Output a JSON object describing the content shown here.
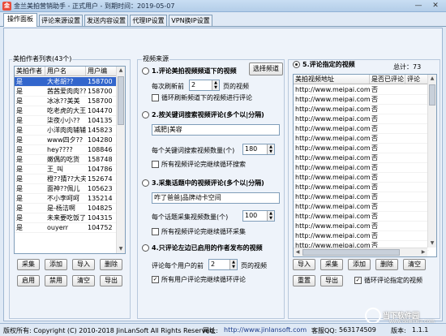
{
  "window": {
    "title": "金兰美拍营销助手 - 正式用户 - 到期时间：2019-05-07",
    "minimize": "—",
    "close": "✕"
  },
  "tabs": [
    "操作面板",
    "评论来源设置",
    "发送内容设置",
    "代理IP设置",
    "VPN换IP设置"
  ],
  "authors": {
    "group_label": "美拍作者列表(43个)",
    "columns": [
      "美拍作者",
      "用户名",
      "用户编"
    ],
    "rows": [
      [
        "是",
        "大老胡??",
        "158700"
      ],
      [
        "是",
        "茜茜爱肉肉??",
        "158700"
      ],
      [
        "是",
        "冰冰??美美",
        "158700"
      ],
      [
        "是",
        "吃老虎的大王",
        "104470"
      ],
      [
        "是",
        "柒夜小小??",
        "104135"
      ],
      [
        "是",
        "小洋肉肉辅辅",
        "145823"
      ],
      [
        "是",
        "www四夕??",
        "104280"
      ],
      [
        "是",
        "hey????",
        "108846"
      ],
      [
        "是",
        "嫩偶的吃货",
        "158748"
      ],
      [
        "是",
        "王_叫",
        "104786"
      ],
      [
        "是",
        "橙??猜??大夫",
        "152674"
      ],
      [
        "是",
        "面神??佩儿",
        "105623"
      ],
      [
        "是",
        "不小李呵呵",
        "135214"
      ],
      [
        "是",
        "是-杨洁啊",
        "104825"
      ],
      [
        "是",
        "未来要吃饭了",
        "104315"
      ],
      [
        "是",
        "ouyerr",
        "104752"
      ]
    ],
    "buttons": [
      "采集",
      "添加",
      "导入",
      "删除",
      "启用",
      "禁用",
      "清空",
      "导出"
    ]
  },
  "source": {
    "group_label": "视频来源",
    "opt1": {
      "label": "1.评论美拍视频频道下的视频",
      "select_btn": "选择频道",
      "refresh_prefix": "每次刷新前",
      "refresh_value": "2",
      "refresh_suffix": "页的视频",
      "loop_label": "循环刷新频道下的视频进行评论"
    },
    "opt2": {
      "label": "2.按关键词搜索视频评论(多个以|分隔)",
      "keywords": "减肥|美容",
      "count_label": "每个关键词搜索视频数量(个)",
      "count_value": "180",
      "loop_label": "所有视频评论完继续循环搜索"
    },
    "opt3": {
      "label": "3.采集话题中的视频评论(多个以|分隔)",
      "topics": "咋了爸爸|品牌动卡空间",
      "count_label": "每个话题采集视频数量(个)",
      "count_value": "100",
      "loop_label": "所有视频评论完继续循环采集"
    },
    "opt4": {
      "label": "4.只评论左边已启用的作者发布的视频",
      "per_user_prefix": "评论每个用户的前",
      "per_user_value": "2",
      "per_user_suffix": "页的视频",
      "loop_label": "所有用户评论完继续循环评论"
    }
  },
  "specified": {
    "label": "5.评论指定的视频",
    "total": "总计：73",
    "columns": [
      "美拍视频地址",
      "是否已评论",
      "评论"
    ],
    "rows": [
      [
        "http://www.meipai.com/m",
        "否"
      ],
      [
        "http://www.meipai.com/m",
        "否"
      ],
      [
        "http://www.meipai.com/m",
        "否"
      ],
      [
        "http://www.meipai.com/m",
        "否"
      ],
      [
        "http://www.meipai.com/m",
        "否"
      ],
      [
        "http://www.meipai.com/m",
        "否"
      ],
      [
        "http://www.meipai.com/m",
        "否"
      ],
      [
        "http://www.meipai.com/m",
        "否"
      ],
      [
        "http://www.meipai.com/m",
        "否"
      ],
      [
        "http://www.meipai.com/m",
        "否"
      ],
      [
        "http://www.meipai.com/m",
        "否"
      ],
      [
        "http://www.meipai.com/m",
        "否"
      ],
      [
        "http://www.meipai.com/m",
        "否"
      ],
      [
        "http://www.meipai.com/m",
        "否"
      ],
      [
        "http://www.meipai.com/m",
        "否"
      ],
      [
        "http://www.meipai.com/m",
        "否"
      ],
      [
        "http://www.meipai.com/m",
        "否"
      ]
    ],
    "buttons": [
      "导入",
      "采集",
      "添加",
      "删除",
      "清空",
      "重置",
      "导出"
    ],
    "loop_label": "循环评论指定的视频"
  },
  "status": {
    "copyright": "版权所有: Copyright (C) 2010-2018 JinLanSoft All Rights Reserved.",
    "site_label": "网址:",
    "site": "http://www.jinlansoft.com",
    "qq_label": "客服QQ:",
    "qq": "563174509",
    "version_label": "版本:",
    "version": "1.1.1"
  },
  "watermark": {
    "brand": "当下软件园",
    "url": "www.downxia.com"
  }
}
